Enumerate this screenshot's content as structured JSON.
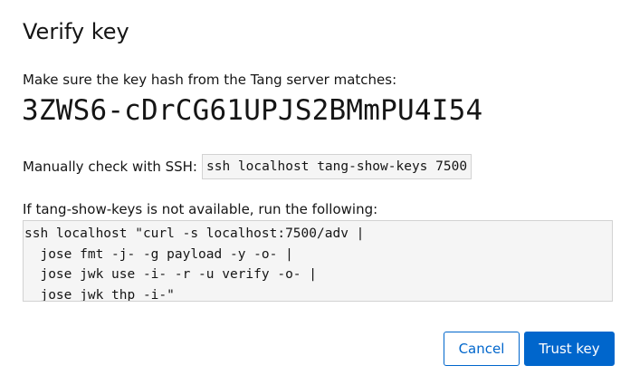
{
  "dialog": {
    "title": "Verify key",
    "hash_prompt": "Make sure the key hash from the Tang server matches:",
    "hash_value": "3ZWS6-cDrCG61UPJS2BMmPU4I54",
    "ssh_label": "Manually check with SSH:",
    "ssh_command": "ssh localhost tang-show-keys 7500",
    "fallback_prompt": "If tang-show-keys is not available, run the following:",
    "fallback_lines": [
      "ssh localhost \"curl -s localhost:7500/adv |",
      "  jose fmt -j- -g payload -y -o- |",
      "  jose jwk use -i- -r -u verify -o- |",
      "  jose jwk thp -i-\""
    ]
  },
  "footer": {
    "cancel_label": "Cancel",
    "trust_label": "Trust key"
  },
  "colors": {
    "accent": "#0066cc",
    "code_bg": "#f5f5f5",
    "code_border": "#d2d2d2"
  }
}
